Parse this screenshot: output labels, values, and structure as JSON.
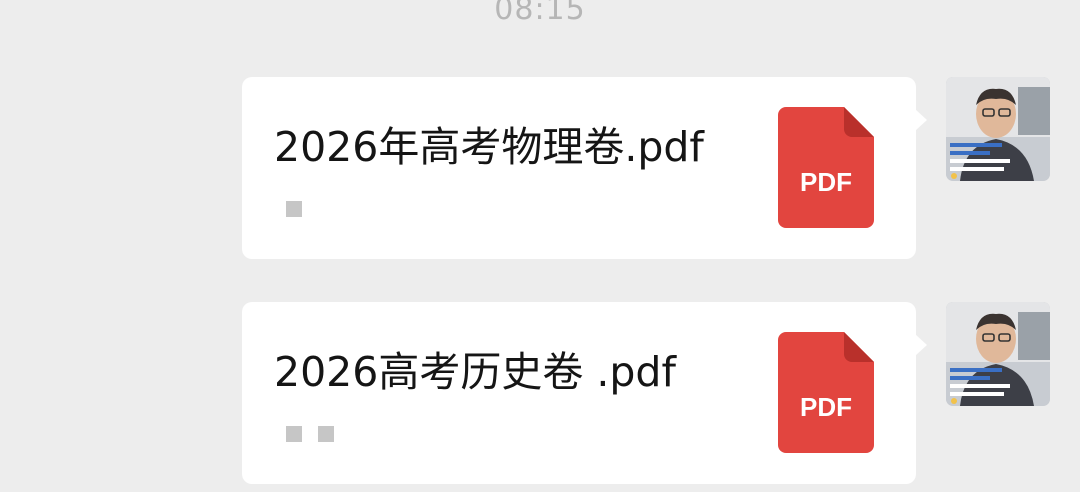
{
  "chat": {
    "timestamp": "08:15",
    "messages": [
      {
        "file_name": "2026年高考物理卷.pdf",
        "file_type_label": "PDF",
        "placeholder_count": 1,
        "icon": "pdf-file-icon",
        "sender_avatar": "avatar-photo"
      },
      {
        "file_name": "2026高考历史卷 .pdf",
        "file_type_label": "PDF",
        "placeholder_count": 2,
        "icon": "pdf-file-icon",
        "sender_avatar": "avatar-photo"
      }
    ]
  },
  "colors": {
    "background": "#ededed",
    "bubble": "#ffffff",
    "pdf_red": "#e2453f",
    "pdf_fold": "#b9302b",
    "timestamp": "#b6b6b6"
  }
}
